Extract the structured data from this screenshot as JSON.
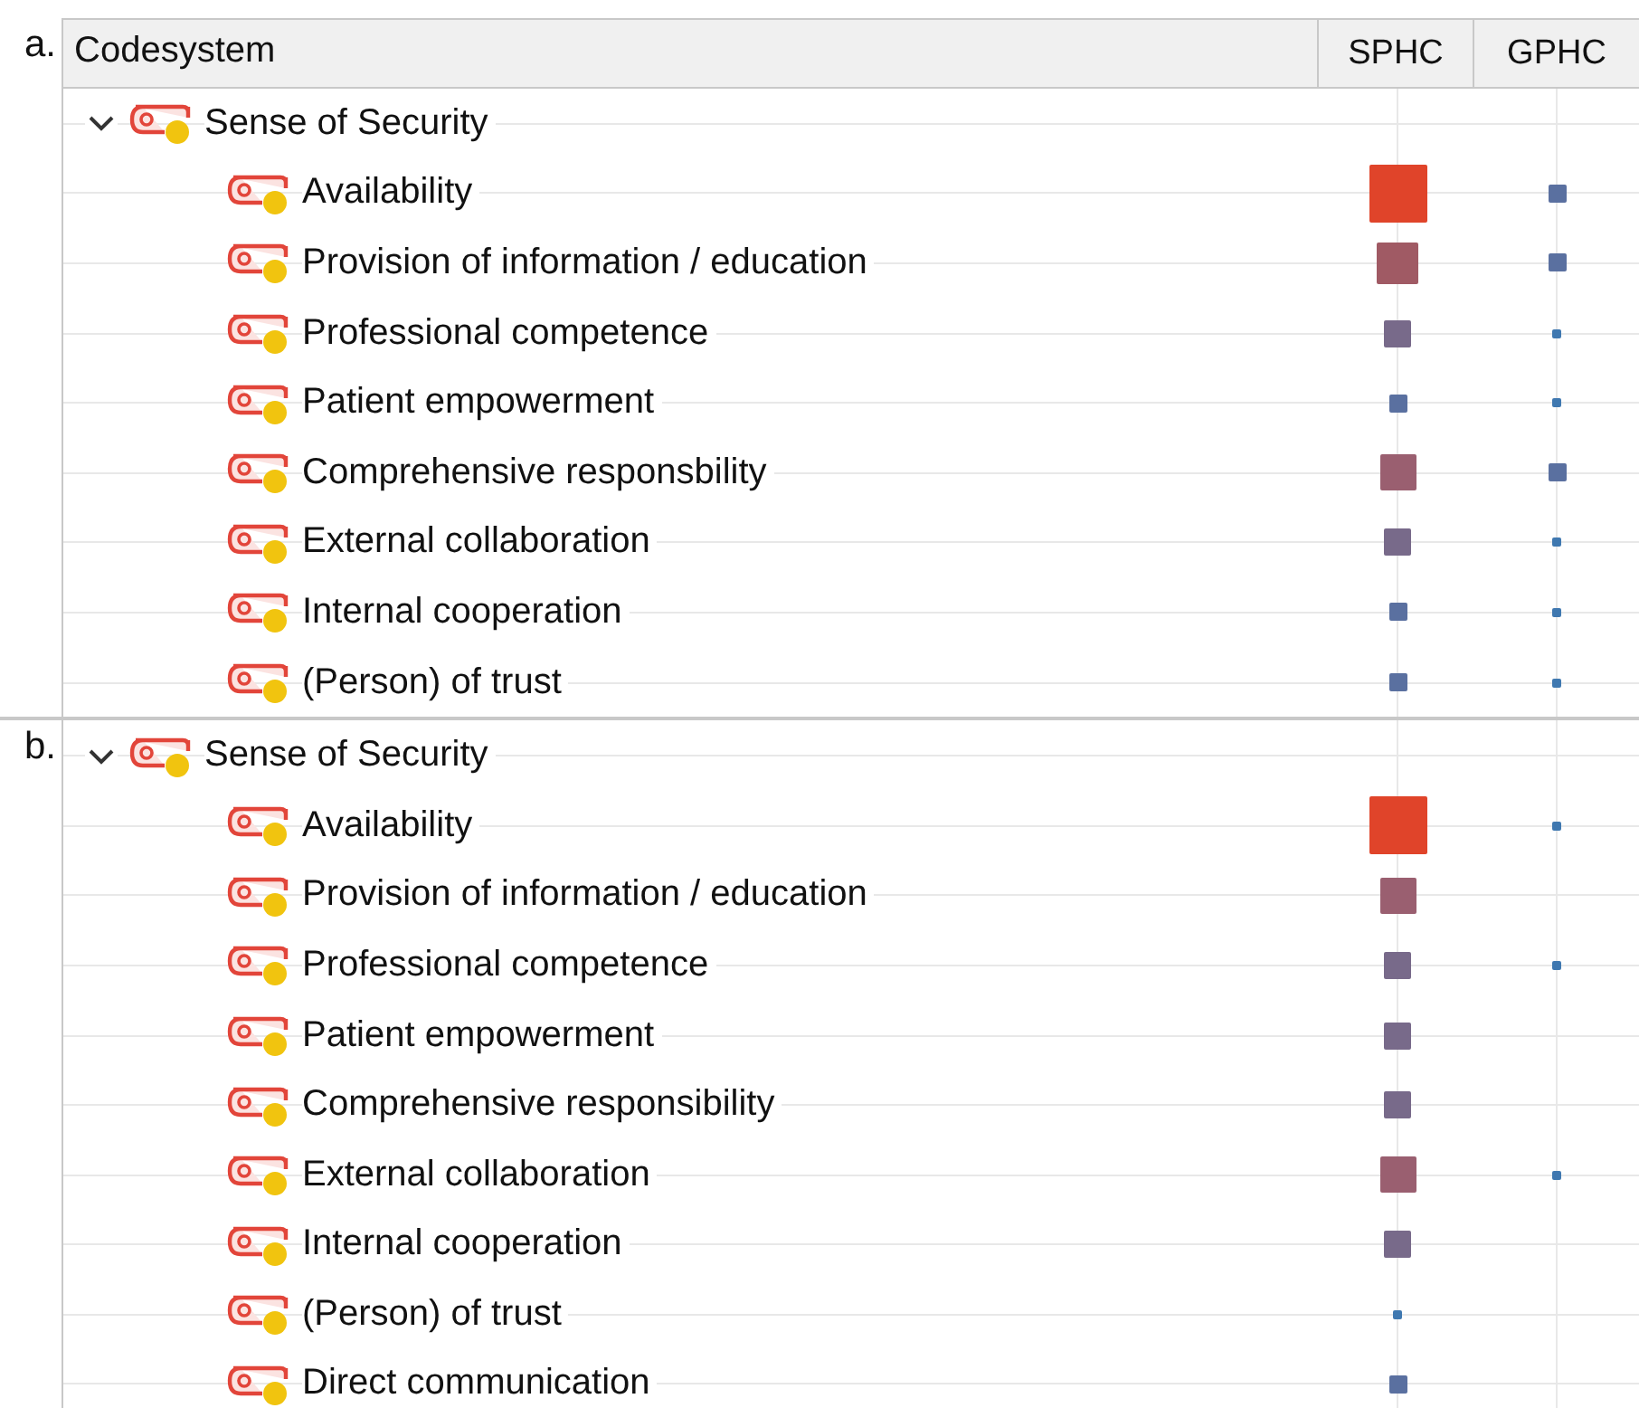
{
  "header": {
    "columns": [
      "Codesystem",
      "SPHC",
      "GPHC"
    ]
  },
  "panels": [
    {
      "label": "a.",
      "root": {
        "name": "Sense of Security",
        "expanded": true,
        "children": [
          {
            "name": "Availability",
            "cells": [
              {
                "kind": "huge"
              },
              {
                "kind": "small"
              }
            ]
          },
          {
            "name": "Provision of information / education",
            "cells": [
              {
                "kind": "large"
              },
              {
                "kind": "small"
              }
            ]
          },
          {
            "name": "Professional competence",
            "cells": [
              {
                "kind": "medium"
              },
              {
                "kind": "tiny"
              }
            ]
          },
          {
            "name": "Patient empowerment",
            "cells": [
              {
                "kind": "small"
              },
              {
                "kind": "tiny"
              }
            ]
          },
          {
            "name": "Comprehensive responsbility",
            "cells": [
              {
                "kind": "big"
              },
              {
                "kind": "small"
              }
            ]
          },
          {
            "name": "External collaboration",
            "cells": [
              {
                "kind": "medium"
              },
              {
                "kind": "tiny"
              }
            ]
          },
          {
            "name": "Internal cooperation",
            "cells": [
              {
                "kind": "small"
              },
              {
                "kind": "tiny"
              }
            ]
          },
          {
            "name": "(Person) of trust",
            "cells": [
              {
                "kind": "small"
              },
              {
                "kind": "tiny"
              }
            ]
          }
        ]
      }
    },
    {
      "label": "b.",
      "root": {
        "name": "Sense of Security",
        "expanded": true,
        "children": [
          {
            "name": "Availability",
            "cells": [
              {
                "kind": "huge"
              },
              {
                "kind": "tiny"
              }
            ]
          },
          {
            "name": "Provision of information / education",
            "cells": [
              {
                "kind": "big"
              },
              null
            ]
          },
          {
            "name": "Professional competence",
            "cells": [
              {
                "kind": "medium"
              },
              {
                "kind": "tiny"
              }
            ]
          },
          {
            "name": "Patient empowerment",
            "cells": [
              {
                "kind": "medium"
              },
              null
            ]
          },
          {
            "name": "Comprehensive responsibility",
            "cells": [
              {
                "kind": "medium"
              },
              null
            ]
          },
          {
            "name": "External collaboration",
            "cells": [
              {
                "kind": "big"
              },
              {
                "kind": "tiny"
              }
            ]
          },
          {
            "name": "Internal cooperation",
            "cells": [
              {
                "kind": "medium"
              },
              null
            ]
          },
          {
            "name": "(Person) of trust",
            "cells": [
              {
                "kind": "tiny"
              },
              null
            ]
          },
          {
            "name": "Direct communication",
            "cells": [
              {
                "kind": "small"
              },
              null
            ]
          }
        ]
      }
    }
  ]
}
